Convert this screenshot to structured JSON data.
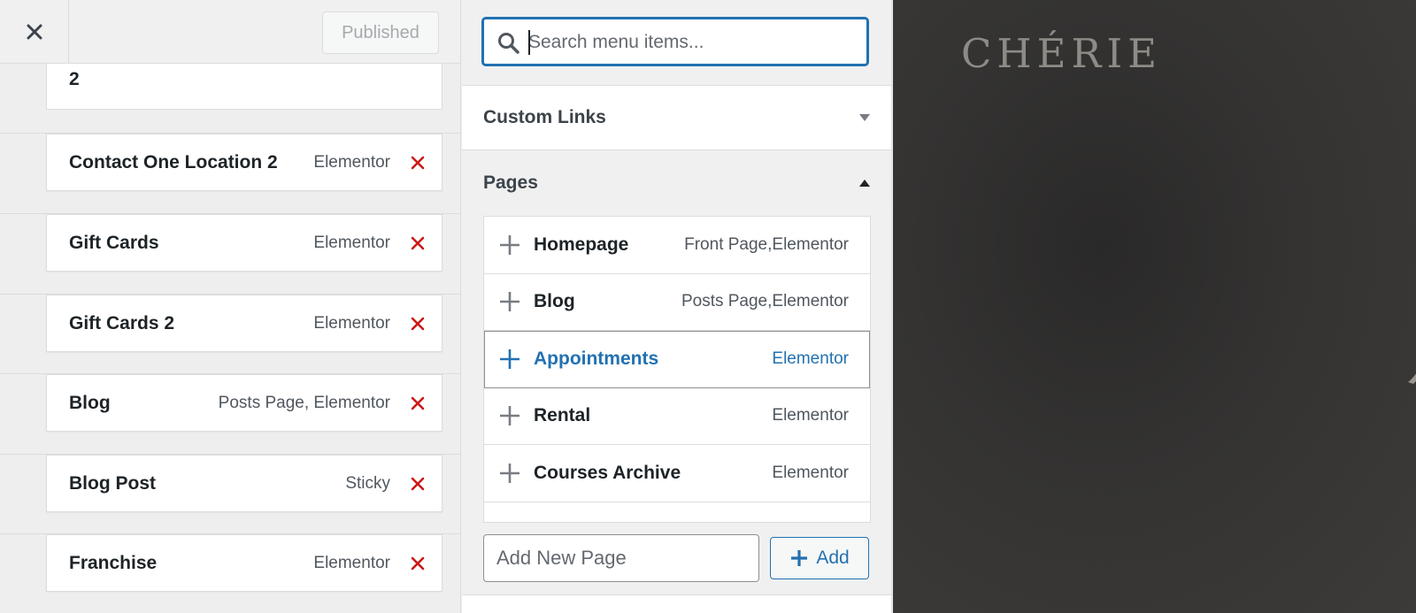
{
  "customizer": {
    "publish_label": "Published"
  },
  "menu_items": {
    "first_fragment": "2",
    "items": [
      {
        "title": "Contact One Location 2",
        "type": "Elementor"
      },
      {
        "title": "Gift Cards",
        "type": "Elementor"
      },
      {
        "title": "Gift Cards 2",
        "type": "Elementor"
      },
      {
        "title": "Blog",
        "type": "Posts Page, Elementor"
      },
      {
        "title": "Blog Post",
        "type": "Sticky"
      },
      {
        "title": "Franchise",
        "type": "Elementor"
      }
    ]
  },
  "add_items_panel": {
    "search_placeholder": "Search menu items...",
    "custom_links_label": "Custom Links",
    "pages_label": "Pages",
    "pages": [
      {
        "title": "Homepage",
        "type": "Front Page,Elementor"
      },
      {
        "title": "Blog",
        "type": "Posts Page,Elementor"
      },
      {
        "title": "Appointments",
        "type": "Elementor"
      },
      {
        "title": "Rental",
        "type": "Elementor"
      },
      {
        "title": "Courses Archive",
        "type": "Elementor"
      }
    ],
    "new_page_placeholder": "Add New Page",
    "add_label": "Add"
  },
  "preview": {
    "brand": "CHÉRIE"
  },
  "colors": {
    "accent": "#2271b1",
    "remove": "#cc1818",
    "preview_bg": "#343332"
  },
  "icons": {
    "close": "close-icon",
    "search": "search-icon",
    "remove": "remove-x-icon",
    "collapse": "triangle-icon",
    "add": "plus-icon"
  }
}
